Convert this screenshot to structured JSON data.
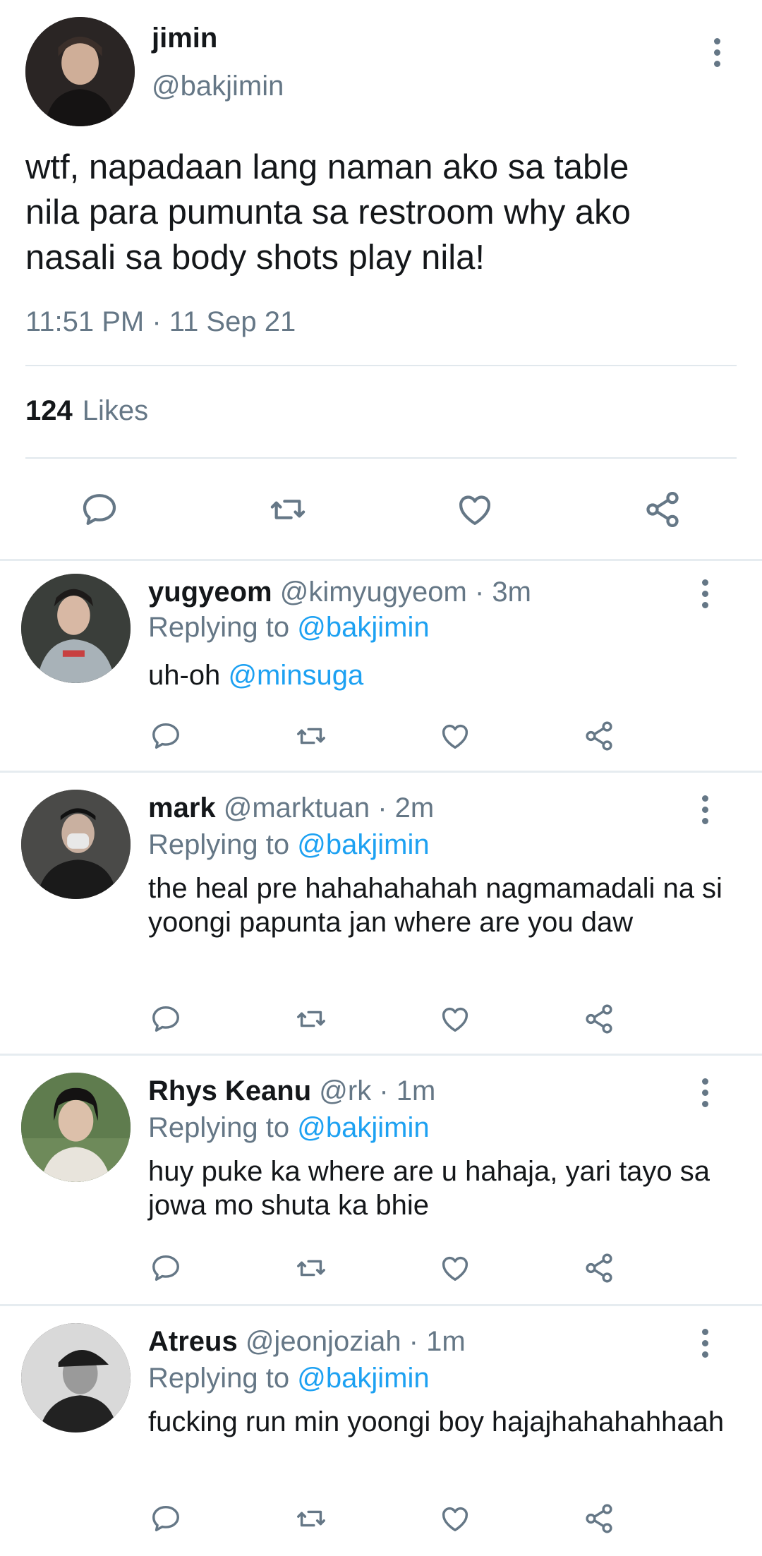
{
  "main_tweet": {
    "name": "jimin",
    "handle": "@bakjimin",
    "text": "wtf, napadaan lang naman ako sa table\nnila para pumunta sa restroom why ako\nnasali sa body shots play nila!",
    "timestamp": "11:51 PM · 11 Sep 21",
    "likes_count": "124",
    "likes_label": "Likes"
  },
  "icons": {
    "menu": "more-vertical-icon",
    "reply": "comment-icon",
    "retweet": "retweet-icon",
    "like": "heart-icon",
    "share": "share-icon"
  },
  "colors": {
    "text": "#14171a",
    "muted": "#657786",
    "link": "#1da1f2",
    "divider": "#e1e8ed"
  },
  "replies": [
    {
      "name": "yugyeom",
      "meta": "@kimyugyeom · 3m",
      "replying_prefix": "Replying to",
      "replying_to": "@bakjimin",
      "text": "uh-oh",
      "text_mention": "@minsuga"
    },
    {
      "name": "mark",
      "meta": "@marktuan · 2m",
      "replying_prefix": "Replying to",
      "replying_to": "@bakjimin",
      "text": "the heal pre hahahahahah nagmamadali na si yoongi papunta jan where are you daw"
    },
    {
      "name": "Rhys Keanu",
      "meta": "@rk · 1m",
      "replying_prefix": "Replying to",
      "replying_to": "@bakjimin",
      "text": "huy puke ka where are u hahaja, yari tayo sa jowa mo shuta ka bhie"
    },
    {
      "name": "Atreus",
      "meta": "@jeonjoziah · 1m",
      "replying_prefix": "Replying to",
      "replying_to": "@bakjimin",
      "text": "fucking run min yoongi boy hajajhahahahhaah"
    }
  ]
}
